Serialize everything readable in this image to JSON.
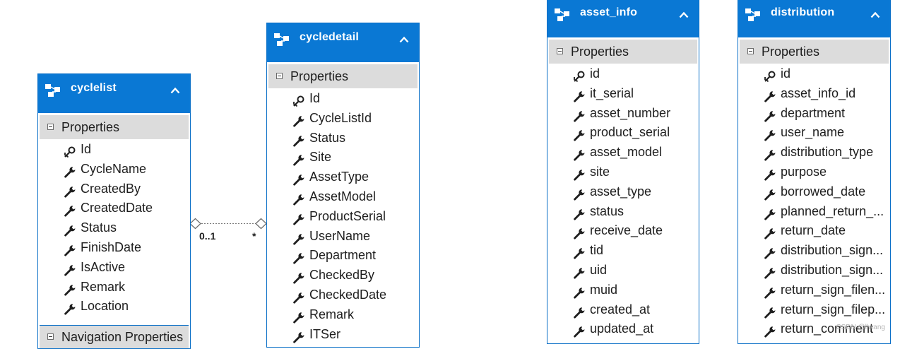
{
  "colors": {
    "header": "#0a78d4",
    "border": "#0a6fc7",
    "section": "#dcdcdc"
  },
  "icons": {
    "entity": "entity-icon",
    "key": "key-icon",
    "property": "wrench-icon",
    "collapse": "chevron-up-icon"
  },
  "entities": [
    {
      "id": "cyclelist",
      "title": "cyclelist",
      "section": "Properties",
      "nav_section": "Navigation Properties",
      "properties": [
        {
          "name": "Id",
          "key": true
        },
        {
          "name": "CycleName",
          "key": false
        },
        {
          "name": "CreatedBy",
          "key": false
        },
        {
          "name": "CreatedDate",
          "key": false
        },
        {
          "name": "Status",
          "key": false
        },
        {
          "name": "FinishDate",
          "key": false
        },
        {
          "name": "IsActive",
          "key": false
        },
        {
          "name": "Remark",
          "key": false
        },
        {
          "name": "Location",
          "key": false
        }
      ]
    },
    {
      "id": "cycledetail",
      "title": "cycledetail",
      "section": "Properties",
      "properties": [
        {
          "name": "Id",
          "key": true
        },
        {
          "name": "CycleListId",
          "key": false
        },
        {
          "name": "Status",
          "key": false
        },
        {
          "name": "Site",
          "key": false
        },
        {
          "name": "AssetType",
          "key": false
        },
        {
          "name": "AssetModel",
          "key": false
        },
        {
          "name": "ProductSerial",
          "key": false
        },
        {
          "name": "UserName",
          "key": false
        },
        {
          "name": "Department",
          "key": false
        },
        {
          "name": "CheckedBy",
          "key": false
        },
        {
          "name": "CheckedDate",
          "key": false
        },
        {
          "name": "Remark",
          "key": false
        },
        {
          "name": "ITSer",
          "key": false
        }
      ]
    },
    {
      "id": "asset_info",
      "title": "asset_info",
      "section": "Properties",
      "properties": [
        {
          "name": "id",
          "key": true
        },
        {
          "name": "it_serial",
          "key": false
        },
        {
          "name": "asset_number",
          "key": false
        },
        {
          "name": "product_serial",
          "key": false
        },
        {
          "name": "asset_model",
          "key": false
        },
        {
          "name": "site",
          "key": false
        },
        {
          "name": "asset_type",
          "key": false
        },
        {
          "name": "status",
          "key": false
        },
        {
          "name": "receive_date",
          "key": false
        },
        {
          "name": "tid",
          "key": false
        },
        {
          "name": "uid",
          "key": false
        },
        {
          "name": "muid",
          "key": false
        },
        {
          "name": "created_at",
          "key": false
        },
        {
          "name": "updated_at",
          "key": false
        }
      ]
    },
    {
      "id": "distribution",
      "title": "distribution",
      "section": "Properties",
      "properties": [
        {
          "name": "id",
          "key": true
        },
        {
          "name": "asset_info_id",
          "key": false
        },
        {
          "name": "department",
          "key": false
        },
        {
          "name": "user_name",
          "key": false
        },
        {
          "name": "distribution_type",
          "key": false
        },
        {
          "name": "purpose",
          "key": false
        },
        {
          "name": "borrowed_date",
          "key": false
        },
        {
          "name": "planned_return_...",
          "key": false
        },
        {
          "name": "return_date",
          "key": false
        },
        {
          "name": "distribution_sign...",
          "key": false
        },
        {
          "name": "distribution_sign...",
          "key": false
        },
        {
          "name": "return_sign_filen...",
          "key": false
        },
        {
          "name": "return_sign_filep...",
          "key": false
        },
        {
          "name": "return_comment",
          "key": false
        }
      ]
    }
  ],
  "association": {
    "left": "0..1",
    "right": "*"
  },
  "watermark": "CSDN @llwang"
}
